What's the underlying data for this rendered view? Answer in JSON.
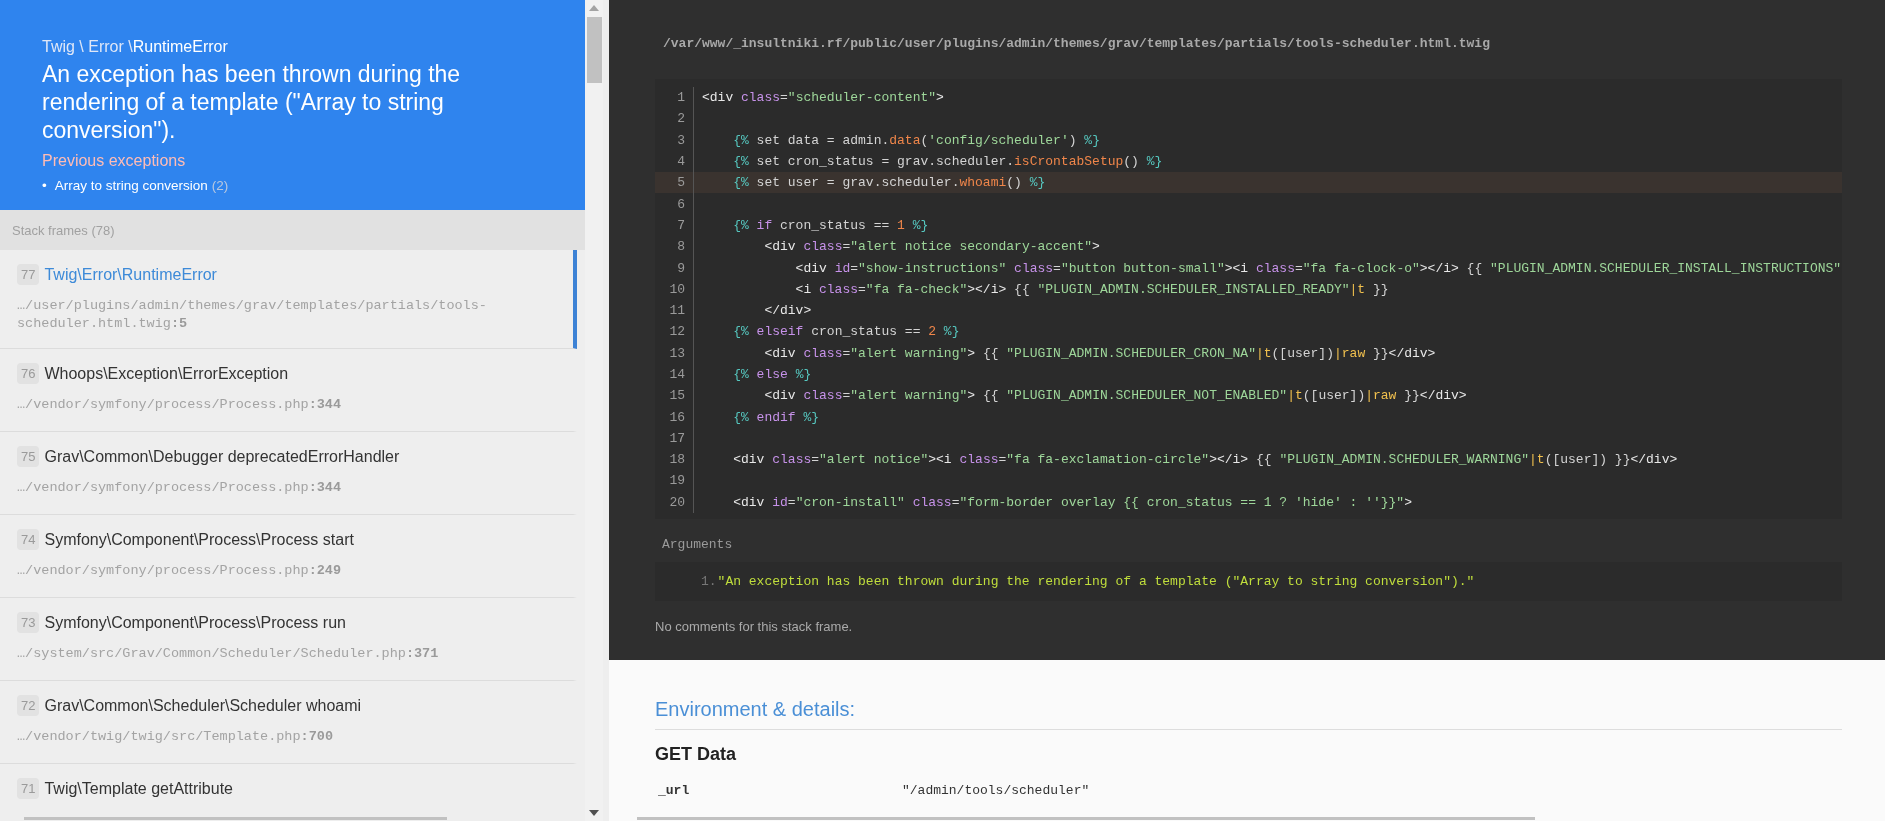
{
  "exception": {
    "namespace": "Twig \\ Error \\",
    "class": "RuntimeError",
    "message": "An exception has been thrown during the rendering of a template (\"Array to string conversion\").",
    "previous_label": "Previous exceptions",
    "previous": [
      {
        "marker": "•",
        "text": "Array to string conversion",
        "count": "(2)"
      }
    ]
  },
  "stack_label": "Stack frames (78)",
  "frames": [
    {
      "number": "77",
      "title": "Twig\\Error\\RuntimeError",
      "file": "…/user/plugins/admin/themes/grav/templates/partials/tools-scheduler.html.twig",
      "line": ":5",
      "selected": true
    },
    {
      "number": "76",
      "title": "Whoops\\Exception\\ErrorException",
      "file": "…/vendor/symfony/process/Process.php",
      "line": ":344",
      "selected": false
    },
    {
      "number": "75",
      "title": "Grav\\Common\\Debugger deprecatedErrorHandler",
      "file": "…/vendor/symfony/process/Process.php",
      "line": ":344",
      "selected": false
    },
    {
      "number": "74",
      "title": "Symfony\\Component\\Process\\Process start",
      "file": "…/vendor/symfony/process/Process.php",
      "line": ":249",
      "selected": false
    },
    {
      "number": "73",
      "title": "Symfony\\Component\\Process\\Process run",
      "file": "…/system/src/Grav/Common/Scheduler/Scheduler.php",
      "line": ":371",
      "selected": false
    },
    {
      "number": "72",
      "title": "Grav\\Common\\Scheduler\\Scheduler whoami",
      "file": "…/vendor/twig/twig/src/Template.php",
      "line": ":700",
      "selected": false
    },
    {
      "number": "71",
      "title": "Twig\\Template getAttribute",
      "selected": false
    }
  ],
  "code": {
    "path": "/var/www/_insultniki.rf/public/user/plugins/admin/themes/grav/templates/partials/tools-scheduler.html.twig",
    "lines": [
      {
        "number": "1",
        "highlighted": false,
        "tokens": [
          {
            "text": "<div",
            "kind": "tag"
          },
          {
            "text": " class",
            "kind": "attr"
          },
          {
            "text": "=",
            "kind": "plain"
          },
          {
            "text": "\"scheduler-content\"",
            "kind": "str"
          },
          {
            "text": ">",
            "kind": "tag"
          }
        ]
      },
      {
        "number": "2",
        "highlighted": false
      },
      {
        "number": "3",
        "highlighted": false,
        "tokens": [
          {
            "text": "    {%",
            "kind": "delim"
          },
          {
            "text": " set data = admin.",
            "kind": "plain"
          },
          {
            "text": "data",
            "kind": "fn"
          },
          {
            "text": "(",
            "kind": "plain"
          },
          {
            "text": "'config/scheduler'",
            "kind": "str"
          },
          {
            "text": ") ",
            "kind": "plain"
          },
          {
            "text": "%}",
            "kind": "delim"
          }
        ]
      },
      {
        "number": "4",
        "highlighted": false,
        "tokens": [
          {
            "text": "    {%",
            "kind": "delim"
          },
          {
            "text": " set cron_status = grav.scheduler.",
            "kind": "plain"
          },
          {
            "text": "isCrontabSetup",
            "kind": "fn"
          },
          {
            "text": "() ",
            "kind": "plain"
          },
          {
            "text": "%}",
            "kind": "delim"
          }
        ]
      },
      {
        "number": "5",
        "highlighted": true,
        "tokens": [
          {
            "text": "    {%",
            "kind": "delim"
          },
          {
            "text": " set user = grav.scheduler.",
            "kind": "plain"
          },
          {
            "text": "whoami",
            "kind": "fn"
          },
          {
            "text": "() ",
            "kind": "plain"
          },
          {
            "text": "%}",
            "kind": "delim"
          }
        ]
      },
      {
        "number": "6",
        "highlighted": false
      },
      {
        "number": "7",
        "highlighted": false,
        "tokens": [
          {
            "text": "    {%",
            "kind": "delim"
          },
          {
            "text": " if",
            "kind": "kw"
          },
          {
            "text": " cron_status == ",
            "kind": "plain"
          },
          {
            "text": "1",
            "kind": "num"
          },
          {
            "text": " %}",
            "kind": "delim"
          }
        ]
      },
      {
        "number": "8",
        "highlighted": false,
        "tokens": [
          {
            "text": "        <div",
            "kind": "tag"
          },
          {
            "text": " class",
            "kind": "attr"
          },
          {
            "text": "=",
            "kind": "plain"
          },
          {
            "text": "\"alert notice secondary-accent\"",
            "kind": "str"
          },
          {
            "text": ">",
            "kind": "tag"
          }
        ]
      },
      {
        "number": "9",
        "highlighted": false,
        "tokens": [
          {
            "text": "            <div",
            "kind": "tag"
          },
          {
            "text": " id",
            "kind": "attr"
          },
          {
            "text": "=",
            "kind": "plain"
          },
          {
            "text": "\"show-instructions\"",
            "kind": "str"
          },
          {
            "text": " class",
            "kind": "attr"
          },
          {
            "text": "=",
            "kind": "plain"
          },
          {
            "text": "\"button button-small\"",
            "kind": "str"
          },
          {
            "text": "><i",
            "kind": "tag"
          },
          {
            "text": " class",
            "kind": "attr"
          },
          {
            "text": "=",
            "kind": "plain"
          },
          {
            "text": "\"fa fa-clock-o\"",
            "kind": "str"
          },
          {
            "text": "></i>",
            "kind": "tag"
          },
          {
            "text": " {{ ",
            "kind": "plain"
          },
          {
            "text": "\"PLUGIN_ADMIN.SCHEDULER_INSTALL_INSTRUCTIONS\"",
            "kind": "str"
          }
        ]
      },
      {
        "number": "10",
        "highlighted": false,
        "tokens": [
          {
            "text": "            <i",
            "kind": "tag"
          },
          {
            "text": " class",
            "kind": "attr"
          },
          {
            "text": "=",
            "kind": "plain"
          },
          {
            "text": "\"fa fa-check\"",
            "kind": "str"
          },
          {
            "text": "></i>",
            "kind": "tag"
          },
          {
            "text": " {{ ",
            "kind": "plain"
          },
          {
            "text": "\"PLUGIN_ADMIN.SCHEDULER_INSTALLED_READY\"",
            "kind": "str"
          },
          {
            "text": "|t",
            "kind": "filter"
          },
          {
            "text": " }}",
            "kind": "plain"
          }
        ]
      },
      {
        "number": "11",
        "highlighted": false,
        "tokens": [
          {
            "text": "        </div>",
            "kind": "tag"
          }
        ]
      },
      {
        "number": "12",
        "highlighted": false,
        "tokens": [
          {
            "text": "    {%",
            "kind": "delim"
          },
          {
            "text": " elseif",
            "kind": "kw"
          },
          {
            "text": " cron_status == ",
            "kind": "plain"
          },
          {
            "text": "2",
            "kind": "num"
          },
          {
            "text": " %}",
            "kind": "delim"
          }
        ]
      },
      {
        "number": "13",
        "highlighted": false,
        "tokens": [
          {
            "text": "        <div",
            "kind": "tag"
          },
          {
            "text": " class",
            "kind": "attr"
          },
          {
            "text": "=",
            "kind": "plain"
          },
          {
            "text": "\"alert warning\"",
            "kind": "str"
          },
          {
            "text": ">",
            "kind": "tag"
          },
          {
            "text": " {{ ",
            "kind": "plain"
          },
          {
            "text": "\"PLUGIN_ADMIN.SCHEDULER_CRON_NA\"",
            "kind": "str"
          },
          {
            "text": "|t",
            "kind": "filter"
          },
          {
            "text": "([user])",
            "kind": "plain"
          },
          {
            "text": "|raw",
            "kind": "filter"
          },
          {
            "text": " }}",
            "kind": "plain"
          },
          {
            "text": "</div>",
            "kind": "tag"
          }
        ]
      },
      {
        "number": "14",
        "highlighted": false,
        "tokens": [
          {
            "text": "    {%",
            "kind": "delim"
          },
          {
            "text": " else",
            "kind": "kw"
          },
          {
            "text": " %}",
            "kind": "delim"
          }
        ]
      },
      {
        "number": "15",
        "highlighted": false,
        "tokens": [
          {
            "text": "        <div",
            "kind": "tag"
          },
          {
            "text": " class",
            "kind": "attr"
          },
          {
            "text": "=",
            "kind": "plain"
          },
          {
            "text": "\"alert warning\"",
            "kind": "str"
          },
          {
            "text": ">",
            "kind": "tag"
          },
          {
            "text": " {{ ",
            "kind": "plain"
          },
          {
            "text": "\"PLUGIN_ADMIN.SCHEDULER_NOT_ENABLED\"",
            "kind": "str"
          },
          {
            "text": "|t",
            "kind": "filter"
          },
          {
            "text": "([user])",
            "kind": "plain"
          },
          {
            "text": "|raw",
            "kind": "filter"
          },
          {
            "text": " }}",
            "kind": "plain"
          },
          {
            "text": "</div>",
            "kind": "tag"
          }
        ]
      },
      {
        "number": "16",
        "highlighted": false,
        "tokens": [
          {
            "text": "    {%",
            "kind": "delim"
          },
          {
            "text": " endif",
            "kind": "kw"
          },
          {
            "text": " %}",
            "kind": "delim"
          }
        ]
      },
      {
        "number": "17",
        "highlighted": false
      },
      {
        "number": "18",
        "highlighted": false,
        "tokens": [
          {
            "text": "    <div",
            "kind": "tag"
          },
          {
            "text": " class",
            "kind": "attr"
          },
          {
            "text": "=",
            "kind": "plain"
          },
          {
            "text": "\"alert notice\"",
            "kind": "str"
          },
          {
            "text": "><i",
            "kind": "tag"
          },
          {
            "text": " class",
            "kind": "attr"
          },
          {
            "text": "=",
            "kind": "plain"
          },
          {
            "text": "\"fa fa-exclamation-circle\"",
            "kind": "str"
          },
          {
            "text": "></i>",
            "kind": "tag"
          },
          {
            "text": " {{ ",
            "kind": "plain"
          },
          {
            "text": "\"PLUGIN_ADMIN.SCHEDULER_WARNING\"",
            "kind": "str"
          },
          {
            "text": "|t",
            "kind": "filter"
          },
          {
            "text": "([user]) }}",
            "kind": "plain"
          },
          {
            "text": "</div>",
            "kind": "tag"
          }
        ]
      },
      {
        "number": "19",
        "highlighted": false
      },
      {
        "number": "20",
        "highlighted": false,
        "tokens": [
          {
            "text": "    <div",
            "kind": "tag"
          },
          {
            "text": " id",
            "kind": "attr"
          },
          {
            "text": "=",
            "kind": "plain"
          },
          {
            "text": "\"cron-install\"",
            "kind": "str"
          },
          {
            "text": " class",
            "kind": "attr"
          },
          {
            "text": "=",
            "kind": "plain"
          },
          {
            "text": "\"form-border overlay {{ cron_status == 1 ? 'hide' : ''}}\"",
            "kind": "str"
          },
          {
            "text": ">",
            "kind": "tag"
          }
        ]
      }
    ]
  },
  "arguments": {
    "label": "Arguments",
    "items": [
      {
        "number": "1.",
        "value": "\"An exception has been thrown during the rendering of a template (\"Array to string conversion\").\""
      }
    ]
  },
  "comments": "No comments for this stack frame.",
  "environment": {
    "title": "Environment & details:",
    "sections": [
      {
        "title": "GET Data",
        "rows": [
          {
            "key": "_url",
            "value": "\"/admin/tools/scheduler\""
          }
        ]
      }
    ]
  }
}
